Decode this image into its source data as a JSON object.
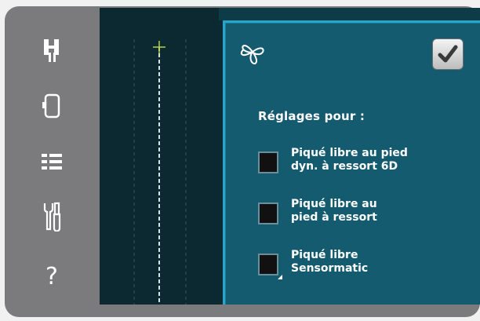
{
  "sidebar": {
    "items": [
      {
        "icon": "presser-foot-icon"
      },
      {
        "icon": "frame-icon"
      },
      {
        "icon": "menu-list-icon"
      },
      {
        "icon": "settings-tools-icon"
      },
      {
        "icon": "help-icon",
        "glyph": "?"
      }
    ]
  },
  "dialog": {
    "icon": "free-motion-icon",
    "ok_icon": "checkmark-icon",
    "heading": "Réglages pour :",
    "options": [
      {
        "line1": "Piqué libre au pied",
        "line2": "dyn. à ressort 6D",
        "checked": false
      },
      {
        "line1": "Piqué libre au",
        "line2": "pied à ressort",
        "checked": false
      },
      {
        "line1": "Piqué libre",
        "line2": "Sensormatic",
        "checked": false
      }
    ]
  },
  "colors": {
    "dialog_bg": "#155b70",
    "dialog_border": "#2aa4c8",
    "screen_bg": "#0b2a33",
    "bezel": "#7b7b7d"
  }
}
